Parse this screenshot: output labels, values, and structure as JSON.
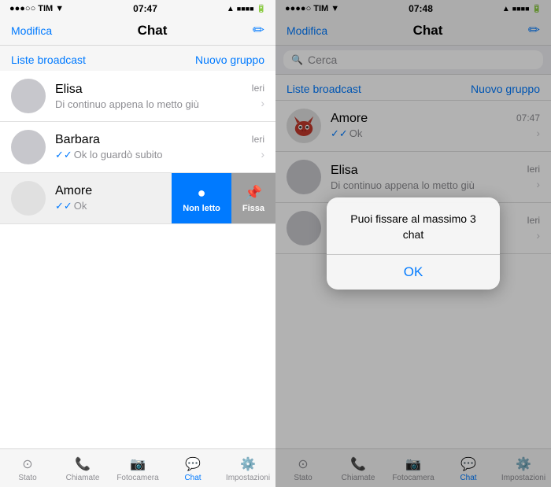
{
  "left": {
    "statusBar": {
      "carrier": "●●●○○ TIM ▼",
      "time": "07:47",
      "icons": "▲ ■ 🔋"
    },
    "navBar": {
      "leftLabel": "Modifica",
      "title": "Chat",
      "rightIcon": "✏️"
    },
    "broadcastLabel": "Liste broadcast",
    "newGroupLabel": "Nuovo gruppo",
    "chats": [
      {
        "name": "Elisa",
        "preview": "Di continuo appena lo metto giù",
        "time": "Ieri",
        "hasDoubleCheck": false
      },
      {
        "name": "Barbara",
        "preview": "Ok lo guardò subito",
        "time": "Ieri",
        "hasDoubleCheck": true
      }
    ],
    "amoreChat": {
      "name": "Amore",
      "preview": "Ok",
      "hasDoubleCheck": true
    },
    "swipeUnreadLabel": "Non letto",
    "swipePinLabel": "Fissa",
    "tabBar": {
      "items": [
        {
          "label": "Stato",
          "icon": "⊙",
          "active": false
        },
        {
          "label": "Chiamate",
          "icon": "📞",
          "active": false
        },
        {
          "label": "Fotocamera",
          "icon": "📷",
          "active": false
        },
        {
          "label": "Chat",
          "icon": "💬",
          "active": true
        },
        {
          "label": "Impostazioni",
          "icon": "⚙️",
          "active": false
        }
      ]
    }
  },
  "right": {
    "statusBar": {
      "carrier": "●●●●○ TIM ▼",
      "time": "07:48",
      "icons": "▲ ■ 🔋"
    },
    "navBar": {
      "leftLabel": "Modifica",
      "title": "Chat",
      "rightIcon": "✏️"
    },
    "searchPlaceholder": "Cerca",
    "broadcastLabel": "Liste broadcast",
    "newGroupLabel": "Nuovo gruppo",
    "chats": [
      {
        "name": "Amore",
        "preview": "Ok",
        "time": "07:47",
        "hasDoubleCheck": true,
        "hasDevilAvatar": true
      },
      {
        "name": "Elisa",
        "preview": "Di continuo appena lo metto giù",
        "time": "Ieri",
        "hasDoubleCheck": false
      },
      {
        "name": "",
        "preview": "",
        "time": "Ieri",
        "hasDoubleCheck": false
      }
    ],
    "alert": {
      "message": "Puoi fissare al massimo 3 chat",
      "confirmLabel": "OK"
    },
    "tabBar": {
      "items": [
        {
          "label": "Stato",
          "icon": "⊙",
          "active": false
        },
        {
          "label": "Chiamate",
          "icon": "📞",
          "active": false
        },
        {
          "label": "Fotocamera",
          "icon": "📷",
          "active": false
        },
        {
          "label": "Chat",
          "icon": "💬",
          "active": true
        },
        {
          "label": "Impostazioni",
          "icon": "⚙️",
          "active": false
        }
      ]
    }
  }
}
